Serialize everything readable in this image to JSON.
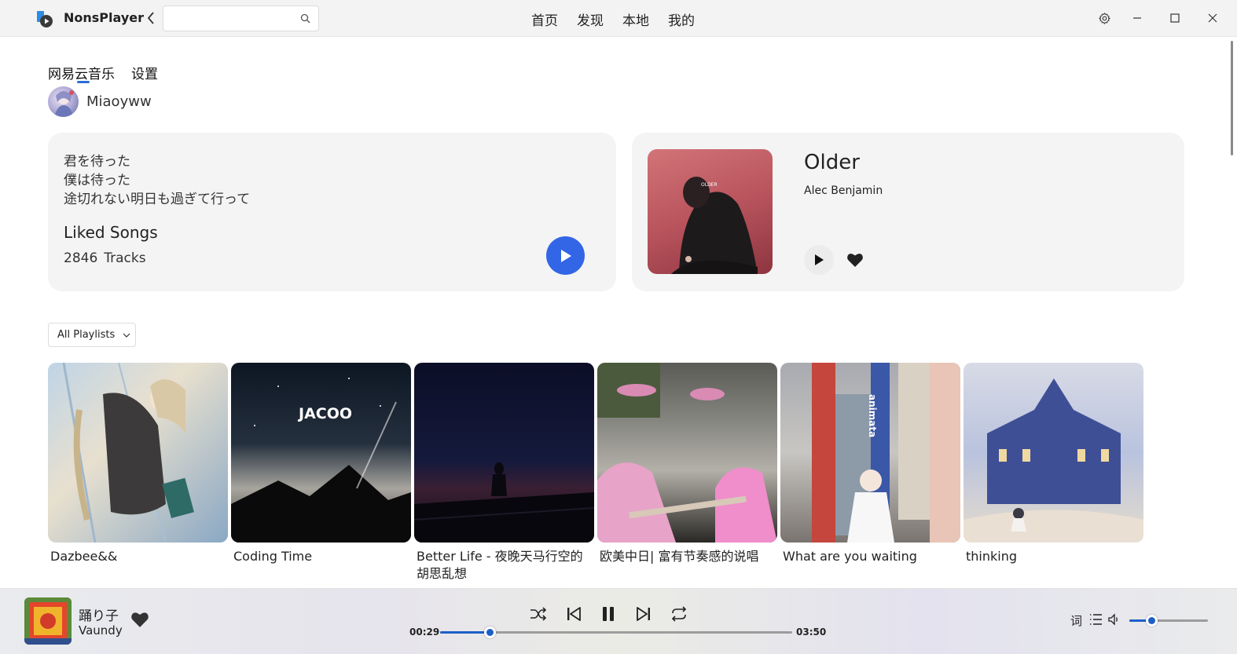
{
  "app": {
    "title": "NonsPlayer"
  },
  "search": {
    "value": "",
    "placeholder": ""
  },
  "nav": [
    {
      "label": "首页"
    },
    {
      "label": "发现"
    },
    {
      "label": "本地"
    },
    {
      "label": "我的"
    }
  ],
  "tabs": [
    {
      "label": "网易云音乐",
      "active": true
    },
    {
      "label": "设置",
      "active": false
    }
  ],
  "user": {
    "name": "Miaoyww"
  },
  "liked": {
    "lyrics": [
      "君を待った",
      "僕は待った",
      "途切れない明日も過ぎて行って"
    ],
    "title": "Liked Songs",
    "count": "2846",
    "count_label": "Tracks"
  },
  "featured_song": {
    "title": "Older",
    "artist": "Alec Benjamin",
    "cover_text": "OLDER"
  },
  "filter": {
    "selected": "All Playlists"
  },
  "playlists": [
    {
      "name": "Dazbee&&"
    },
    {
      "name": "Coding Time",
      "cover_text": "JACOO"
    },
    {
      "name": "Better Life - 夜晚天马行空的胡思乱想"
    },
    {
      "name": "欧美中日| 富有节奏感的说唱"
    },
    {
      "name": "What are you waiting",
      "cover_text": "animata"
    },
    {
      "name": "thinking"
    }
  ],
  "player": {
    "title": "踊り子",
    "artist": "Vaundy",
    "current_time": "00:29",
    "total_time": "03:50",
    "progress": 0.14,
    "volume": 0.28,
    "lyrics_label": "词"
  },
  "colors": {
    "accent": "#3366e6",
    "progress": "#1d5fc7"
  }
}
